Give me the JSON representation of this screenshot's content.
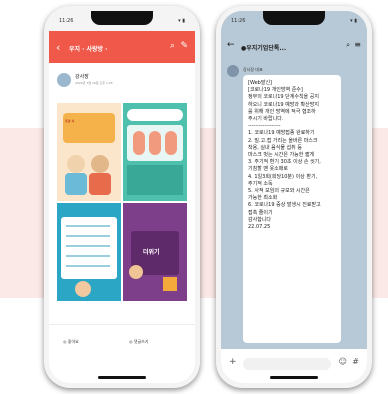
{
  "phone1": {
    "time": "11:26",
    "signal": "▾ ▮",
    "header": {
      "back_icon": "‹",
      "title": "우지 · 사랑방 ·",
      "search_icon": "⌕",
      "edit_icon": "✎"
    },
    "post": {
      "author": "강사장",
      "meta": "2022년 7월 16일 오후 1:25"
    },
    "tiles": [
      {
        "label": "폭염 속"
      },
      {
        "label": ""
      },
      {
        "label": ""
      },
      {
        "label": "더위기"
      }
    ],
    "actions": {
      "like": "◎ 좋아요",
      "comment": "◎ 댓글쓰기"
    }
  },
  "phone2": {
    "time": "11:26",
    "signal": "▾ ▮",
    "header": {
      "back_icon": "←",
      "title": "●우지기업단톡...",
      "search_icon": "⌕",
      "menu_icon": "≡"
    },
    "sender": "강사장 대표",
    "message_lines": [
      "[Web발신]",
      "[코로나19 개인방역 준수]",
      "정부의 코로나19 단계수칙을 공지",
      "하오니 코로나19 예방과 확산방지",
      "를 위해 개인 방역에 적극 협조하",
      "주시기 바랍니다.",
      "------------------",
      "1. 코로나19 예방접종 완료하기",
      "2. 밀.고.접 가리는 올바른 마스크",
      "착용, 실내 음식물 섭취 등",
      "마스크 벗는 시간은 가능한 짧게",
      "3. 주기적 환기 30초 이상 손 씻기,",
      "기침할 땐 옷소매로",
      "4. 1일3회(회당10분) 이상 환기,",
      "주기적 소독",
      "5. 사적 모임의 규모와 시간은",
      "가능한 최소화",
      "6. 코로나19 증상 발생시 진료받고",
      "접촉 줄이기",
      "",
      "감사합니다",
      "22.07.25"
    ],
    "input": {
      "plus_icon": "+",
      "emoji_icon": "☺",
      "hash_icon": "#"
    }
  }
}
